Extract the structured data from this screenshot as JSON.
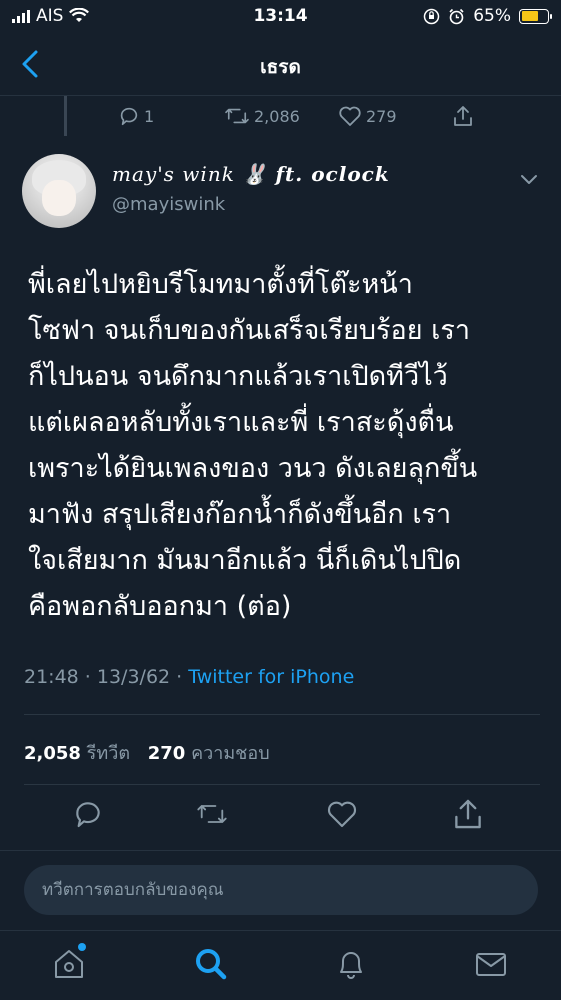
{
  "status_bar": {
    "carrier": "AIS",
    "time": "13:14",
    "battery_percent_label": "65%",
    "battery_level": 0.65
  },
  "nav": {
    "title": "เธรด"
  },
  "previous_tweet": {
    "replies": "1",
    "retweets": "2,086",
    "likes": "279"
  },
  "tweet": {
    "display_name": "may's wink",
    "display_name_emoji": "🐰",
    "display_name_suffix": "ft. oclock",
    "handle": "@mayiswink",
    "lines": [
      "พี่เลยไปหยิบรีโมทมาตั้งที่โต๊ะหน้า",
      "โซฟา จนเก็บของกันเสร็จเรียบร้อย เรา",
      "ก็ไปนอน จนดึกมากแล้วเราเปิดทีวีไว้",
      "แต่เผลอหลับทั้งเราและพี่ เราสะดุ้งตื่น",
      "เพราะได้ยินเพลงของ วนว ดังเลยลุกขึ้น",
      "มาฟัง สรุปเสียงก๊อกน้ำก็ดังขึ้นอีก เรา",
      "ใจเสียมาก มันมาอีกแล้ว นี่ก็เดินไปปิด",
      "คือพอกลับออกมา (ต่อ)"
    ],
    "timestamp": "21:48 · 13/3/62 · ",
    "source": "Twitter for iPhone",
    "retweet_count": "2,058",
    "retweet_label": "รีทวีต",
    "like_count": "270",
    "like_label": "ความชอบ"
  },
  "reply": {
    "placeholder": "ทวีตการตอบกลับของคุณ"
  },
  "colors": {
    "background": "#151f2b",
    "accent": "#1da1f2",
    "muted": "#8899a6",
    "battery": "#f5c518"
  }
}
